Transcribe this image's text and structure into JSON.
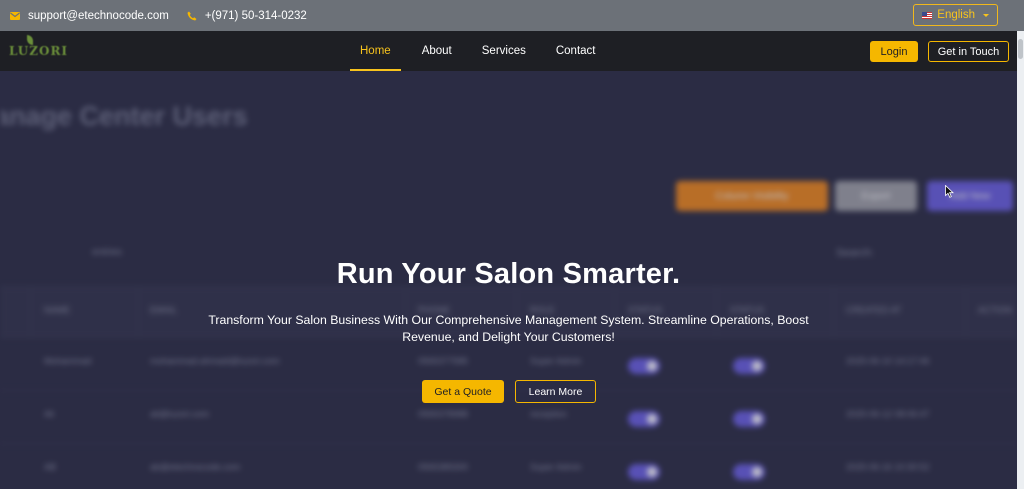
{
  "topbar": {
    "email": "support@etechnocode.com",
    "phone": "+(971) 50-314-0232",
    "language": "English",
    "email_icon": "mail-icon",
    "phone_icon": "phone-icon"
  },
  "navbar": {
    "logo": "LUZORI",
    "links": [
      "Home",
      "About",
      "Services",
      "Contact"
    ],
    "active_link": "Home",
    "login_label": "Login",
    "touch_label": "Get in Touch"
  },
  "hero": {
    "title": "Run Your Salon Smarter.",
    "subtitle": "Transform Your Salon Business With Our Comprehensive Management System. Streamline Operations, Boost Revenue, and Delight Your Customers!",
    "quote_label": "Get a Quote",
    "learn_label": "Learn More"
  },
  "background": {
    "title": "anage Center Users",
    "buttons": [
      "Column Visibility",
      "Export",
      "Add New"
    ],
    "search_label": "Search:",
    "entries_label": "entries",
    "columns": [
      "NAME",
      "EMAIL",
      "PHONE",
      "ROLE",
      "STATUS",
      "STATUS",
      "CREATED AT",
      "ACTION"
    ],
    "rows": [
      {
        "name": "Mohammad",
        "email": "mohammad.ahmadi@luzori.com",
        "phone": "0565377585",
        "role": "Super Admin",
        "created": "2025-06-10 14:17:46"
      },
      {
        "name": "Ali",
        "email": "ali@luzori.com",
        "phone": "0565378988",
        "role": "reception",
        "created": "2025-06-12 08:06:47"
      },
      {
        "name": "AB",
        "email": "ab@etechnocode.com",
        "phone": "0565389300",
        "role": "Super Admin",
        "created": "2025-06-16 10:30:52"
      }
    ]
  },
  "colors": {
    "accent": "#f5b700",
    "navbar_bg": "#1e1f24",
    "topbar_bg": "#6c7178",
    "page_bg": "#2b2c44"
  }
}
